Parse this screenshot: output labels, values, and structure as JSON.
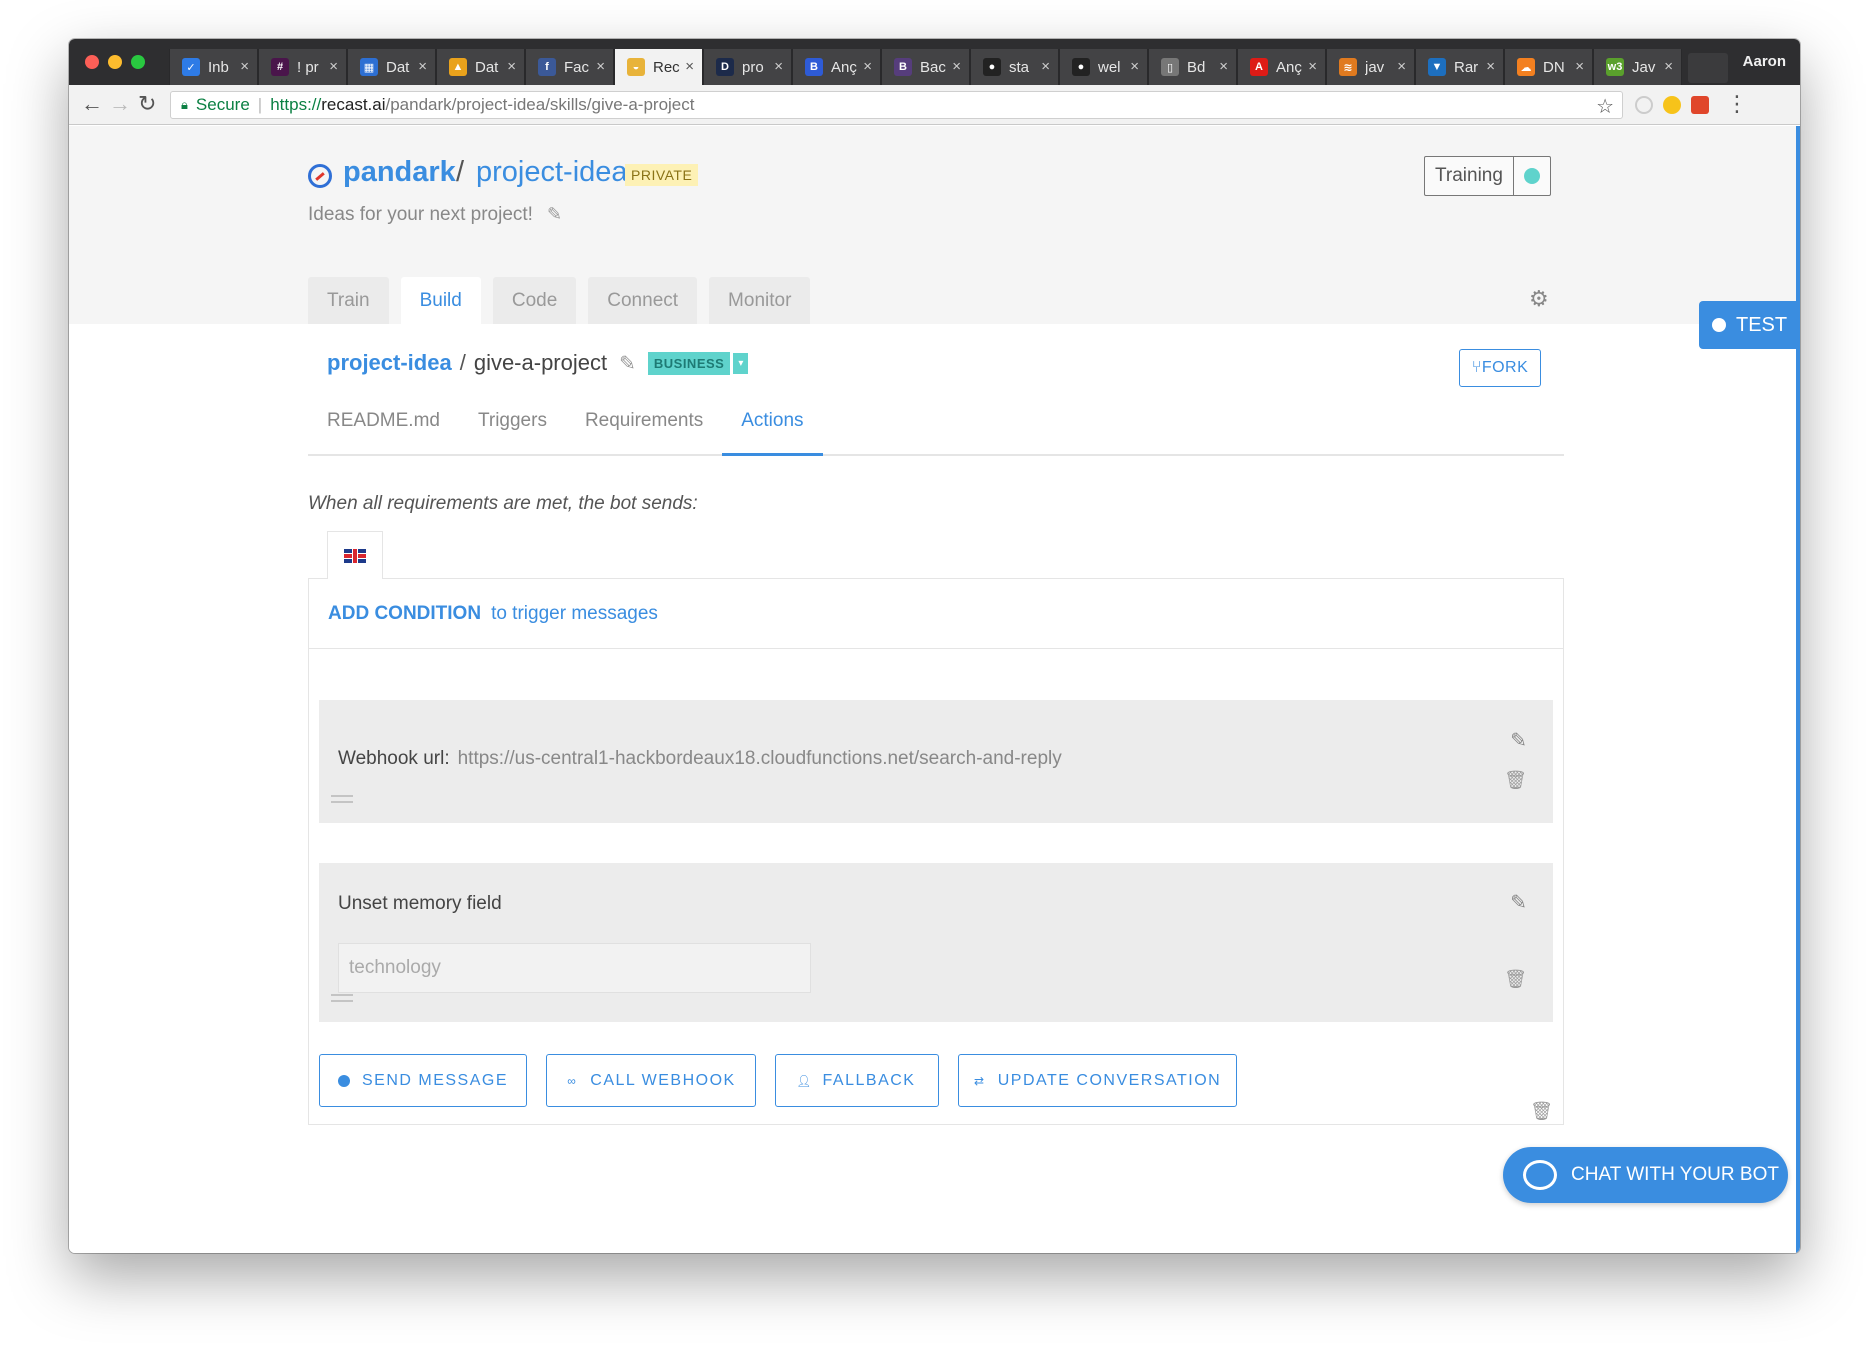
{
  "browser": {
    "profile": "Aaron",
    "tabs": [
      {
        "title": "Inb",
        "icon_color": "#2e7be6",
        "icon_char": "✓"
      },
      {
        "title": "! pr",
        "icon_color": "#4a154b",
        "icon_char": "#"
      },
      {
        "title": "Dat",
        "icon_color": "#2d6fd3",
        "icon_char": "▦"
      },
      {
        "title": "Dat",
        "icon_color": "#e9a21c",
        "icon_char": "▲"
      },
      {
        "title": "Fac",
        "icon_color": "#3b5998",
        "icon_char": "f"
      },
      {
        "title": "Rec",
        "icon_color": "#e8b33a",
        "icon_char": "◒",
        "active": true
      },
      {
        "title": "pro",
        "icon_color": "#1c2a4a",
        "icon_char": "D"
      },
      {
        "title": "Anç",
        "icon_color": "#2e5bd6",
        "icon_char": "B"
      },
      {
        "title": "Bac",
        "icon_color": "#563d7c",
        "icon_char": "B"
      },
      {
        "title": "sta",
        "icon_color": "#222222",
        "icon_char": "●"
      },
      {
        "title": "wel",
        "icon_color": "#222222",
        "icon_char": "●"
      },
      {
        "title": "Bd",
        "icon_color": "#777777",
        "icon_char": "▯"
      },
      {
        "title": "Anç",
        "icon_color": "#dd1b16",
        "icon_char": "A"
      },
      {
        "title": "jav",
        "icon_color": "#e07a1f",
        "icon_char": "≋"
      },
      {
        "title": "Rar",
        "icon_color": "#1d6fbf",
        "icon_char": "▼"
      },
      {
        "title": "DN",
        "icon_color": "#f38020",
        "icon_char": "☁"
      },
      {
        "title": "Jav",
        "icon_color": "#5aa02c",
        "icon_char": "w3"
      }
    ],
    "address": {
      "secure_label": "Secure",
      "url_proto": "https://",
      "url_host": "recast.ai",
      "url_path": "/pandark/project-idea/skills/give-a-project"
    }
  },
  "header": {
    "owner": "pandark",
    "separator": "/",
    "project": "project-idea",
    "visibility": "PRIVATE",
    "description": "Ideas for your next project!",
    "training_label": "Training",
    "training_status_color": "#5fd3cc"
  },
  "main_tabs": [
    {
      "label": "Train"
    },
    {
      "label": "Build",
      "active": true
    },
    {
      "label": "Code"
    },
    {
      "label": "Connect"
    },
    {
      "label": "Monitor"
    }
  ],
  "test_button": "TEST",
  "skill": {
    "project": "project-idea",
    "separator": "/",
    "name": "give-a-project",
    "badge": "BUSINESS",
    "fork_label": "FORK"
  },
  "sub_tabs": [
    {
      "label": "README.md"
    },
    {
      "label": "Triggers"
    },
    {
      "label": "Requirements"
    },
    {
      "label": "Actions",
      "active": true
    }
  ],
  "actions": {
    "intro": "When all requirements are met, the bot sends:",
    "condition": {
      "action": "ADD CONDITION",
      "text": "to trigger messages"
    },
    "webhook": {
      "label": "Webhook url:",
      "url": "https://us-central1-hackbordeaux18.cloudfunctions.net/search-and-reply"
    },
    "memory": {
      "label": "Unset memory field",
      "field": "technology"
    },
    "buttons": {
      "send_message": "SEND MESSAGE",
      "call_webhook": "CALL WEBHOOK",
      "fallback": "FALLBACK",
      "update_conversation": "UPDATE CONVERSATION"
    }
  },
  "chat_button": "CHAT WITH YOUR BOT",
  "colors": {
    "accent": "#3a8de0",
    "business": "#5fd3cc",
    "private_badge": "#fdf1b5"
  }
}
